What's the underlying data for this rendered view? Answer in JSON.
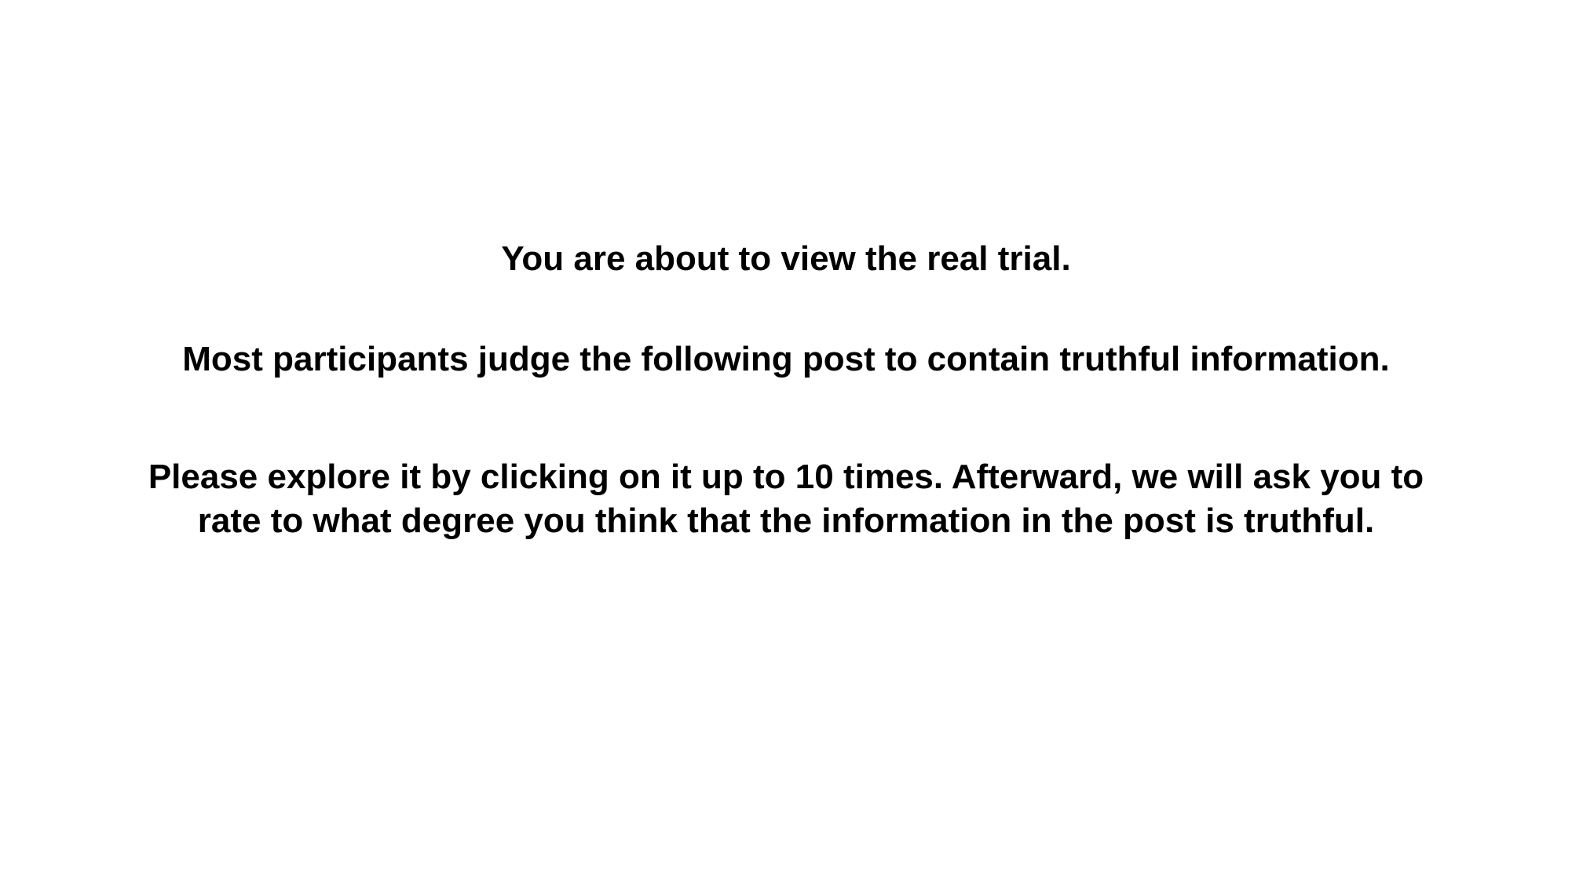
{
  "slide": {
    "heading": "You are about to view the real trial.",
    "social_norm": "Most participants judge the following post to contain truthful information.",
    "instruction_line1": "Please explore it by clicking on it up to 10 times. Afterward, we will ask you to",
    "instruction_line2": "rate to what degree you think that the information in the post is truthful."
  }
}
